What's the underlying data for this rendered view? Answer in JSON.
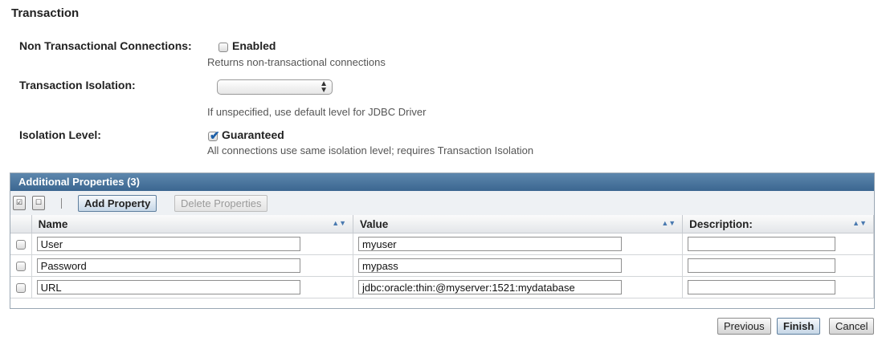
{
  "section": {
    "title": "Transaction"
  },
  "non_transactional": {
    "label": "Non Transactional Connections:",
    "checkbox_label": "Enabled",
    "checked": false,
    "help": "Returns non-transactional connections"
  },
  "isolation": {
    "label": "Transaction Isolation:",
    "selected": "",
    "help": "If unspecified, use default level for JDBC Driver"
  },
  "isolation_level": {
    "label": "Isolation Level:",
    "checkbox_label": "Guaranteed",
    "checked": true,
    "help": "All connections use same isolation level; requires Transaction Isolation"
  },
  "properties": {
    "title": "Additional Properties (3)",
    "select_all_icon": "select-all-icon",
    "deselect_all_icon": "deselect-all-icon",
    "add_label": "Add Property",
    "delete_label": "Delete Properties",
    "columns": [
      "Name",
      "Value",
      "Description:"
    ],
    "rows": [
      {
        "name": "User",
        "value": "myuser",
        "description": ""
      },
      {
        "name": "Password",
        "value": "mypass",
        "description": ""
      },
      {
        "name": "URL",
        "value": "jdbc:oracle:thin:@myserver:1521:mydatabase",
        "description": ""
      }
    ]
  },
  "footer": {
    "previous": "Previous",
    "finish": "Finish",
    "cancel": "Cancel"
  }
}
